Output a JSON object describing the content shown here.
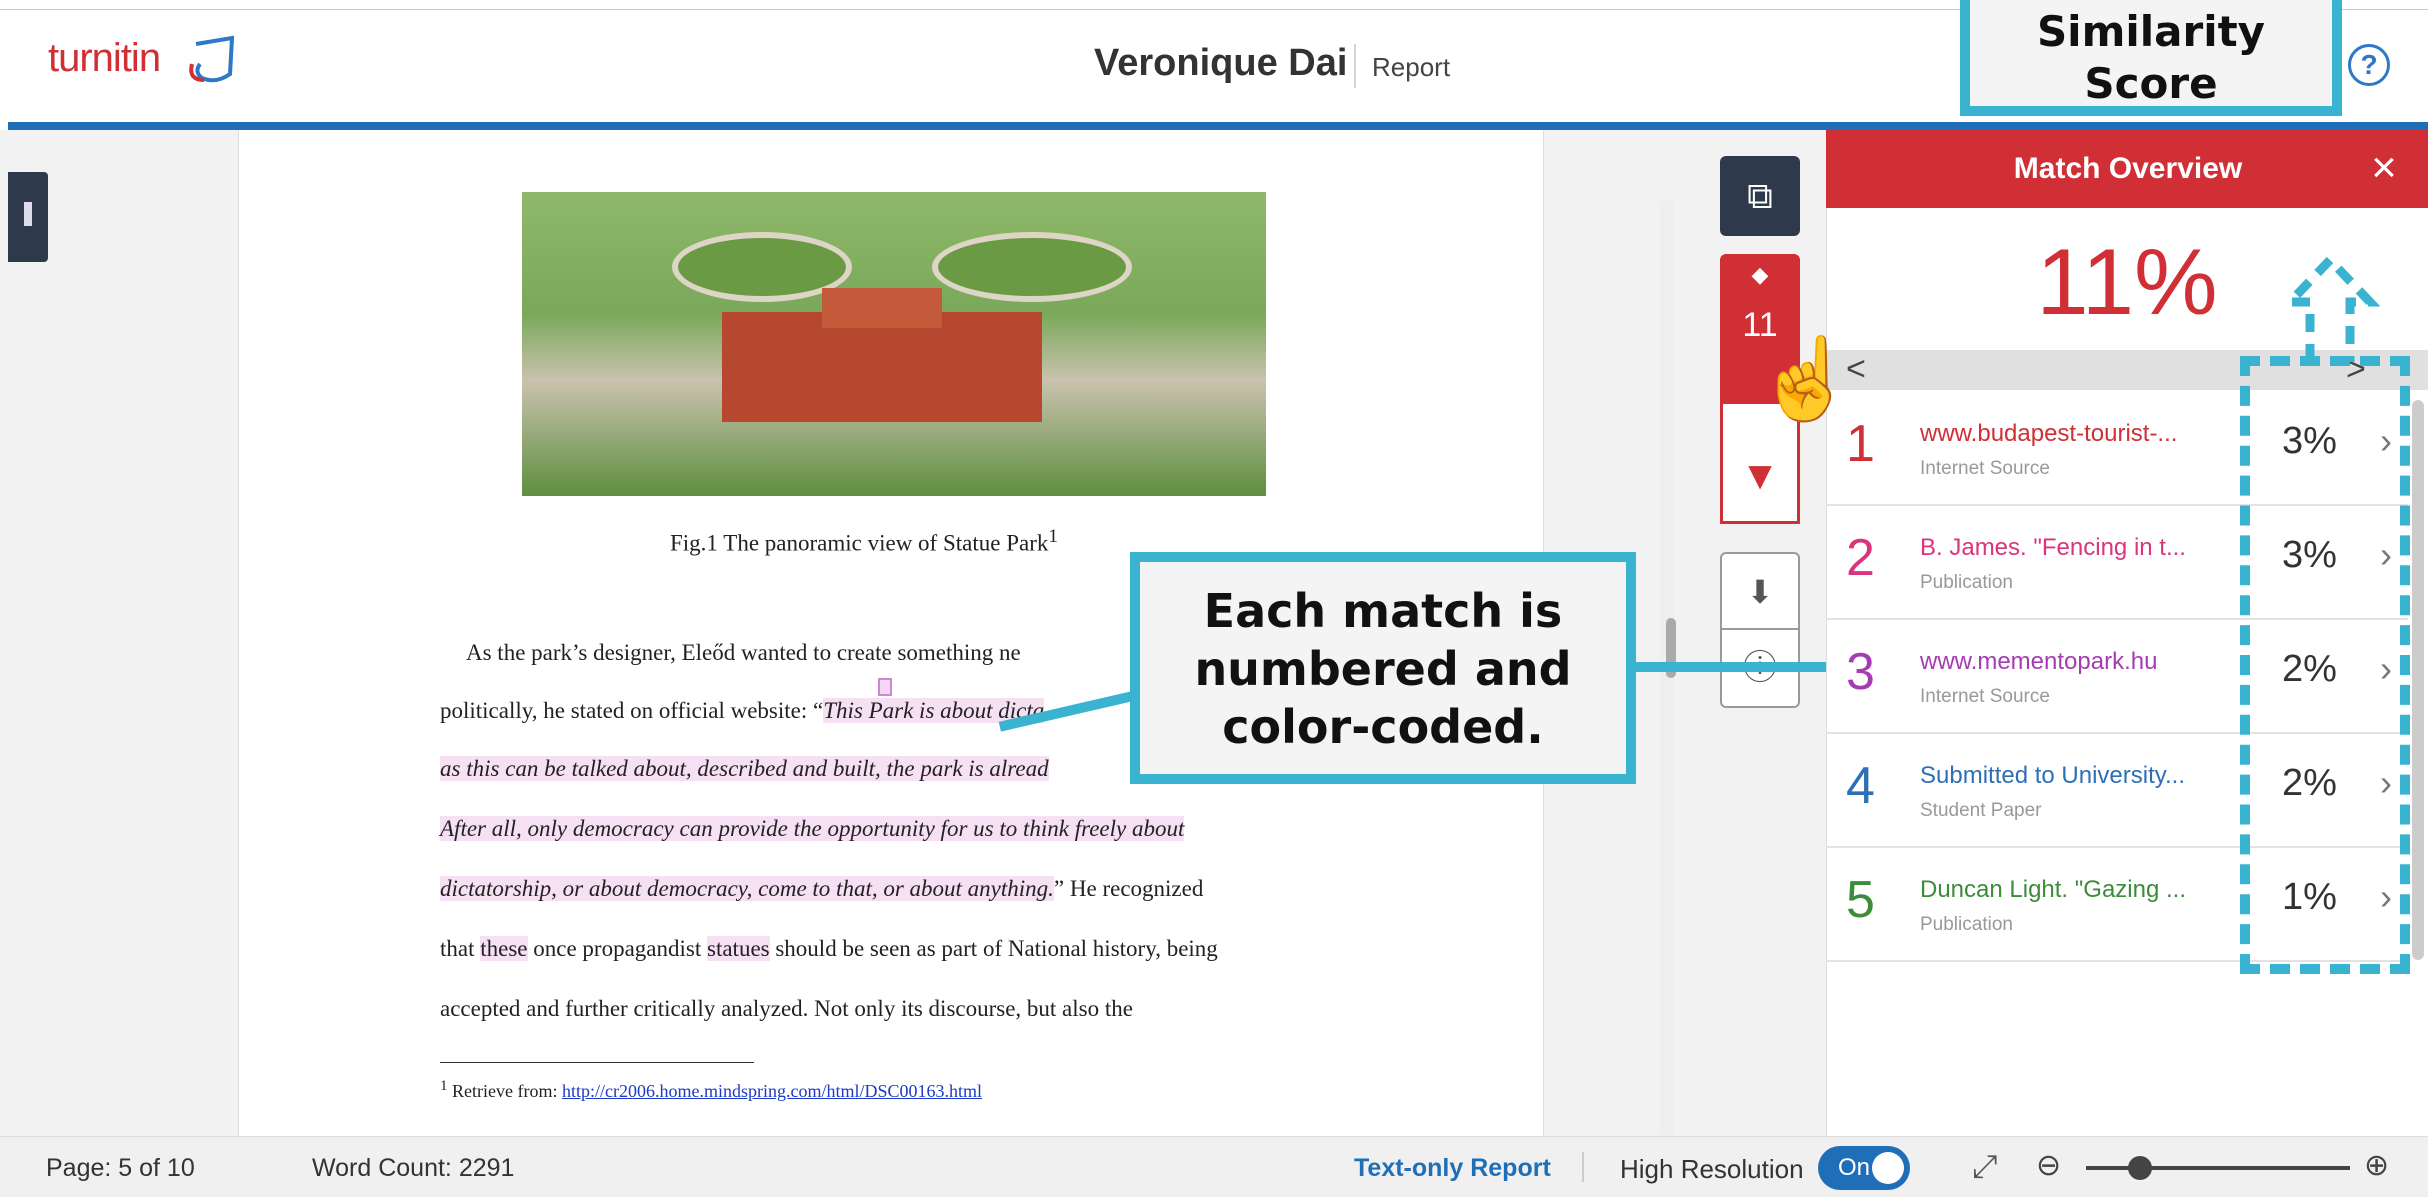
{
  "header": {
    "logo": "turnitin",
    "title": "Veronique Dai",
    "subtitle": "Report",
    "help": "?"
  },
  "document": {
    "caption": "Fig.1 The panoramic view of Statue Park",
    "caption_sup": "1",
    "lines": [
      "As the park’s designer, Eleőd wanted to create something ne",
      "politically, he stated on official website: “",
      "This Park is about dicta",
      "as this can be talked about, described and built, the park is alread",
      "After all, only democracy can provide the opportunity for us to think freely about",
      "dictatorship, or about democracy, come to that, or about anything.",
      "” He recognized",
      "that ",
      "these",
      " once propagandist ",
      "statues",
      " should be seen as part of National history, being",
      "accepted and further critically analyzed. Not only its discourse, but also the"
    ],
    "footnote_prefix": "Retrieve from: ",
    "footnote_sup": "1",
    "footnote_link": "http://cr2006.home.mindspring.com/html/DSC00163.html"
  },
  "toolbar": {
    "layers_icon": "layers-icon",
    "match_count": "11"
  },
  "match_overview": {
    "title": "Match Overview",
    "close": "×",
    "similarity": "11%",
    "prev": "<",
    "next": ">",
    "matches": [
      {
        "num": "1",
        "source": "www.budapest-tourist-...",
        "type": "Internet Source",
        "pct": "3%",
        "color": "#d12f36"
      },
      {
        "num": "2",
        "source": "B. James. \"Fencing in t...",
        "type": "Publication",
        "pct": "3%",
        "color": "#d9347c"
      },
      {
        "num": "3",
        "source": "www.mementopark.hu",
        "type": "Internet Source",
        "pct": "2%",
        "color": "#a63bb3"
      },
      {
        "num": "4",
        "source": "Submitted to University...",
        "type": "Student Paper",
        "pct": "2%",
        "color": "#2e6fb5"
      },
      {
        "num": "5",
        "source": "Duncan Light. \"Gazing ...",
        "type": "Publication",
        "pct": "1%",
        "color": "#3c8c3a"
      }
    ]
  },
  "footer": {
    "page": "Page: 5 of 10",
    "word_count": "Word Count: 2291",
    "text_only": "Text-only Report",
    "high_res": "High Resolution",
    "toggle": "On"
  },
  "callouts": {
    "similarity_line1": "Similarity",
    "similarity_line2": "Score",
    "match_line1": "Each match is",
    "match_line2": "numbered and",
    "match_line3": "color-coded."
  }
}
